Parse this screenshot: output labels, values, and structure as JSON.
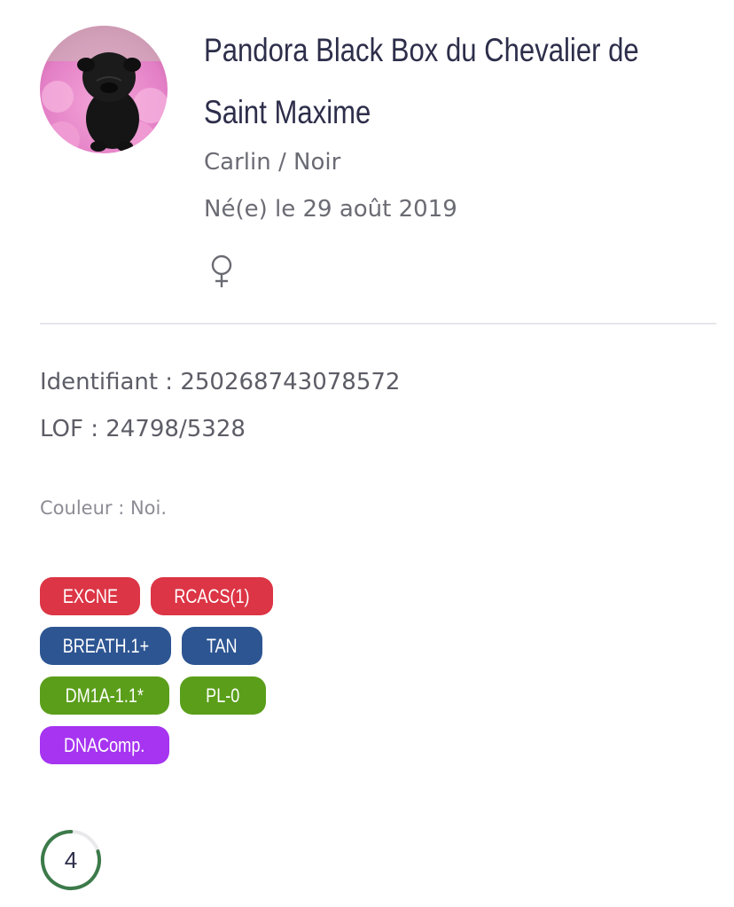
{
  "dog": {
    "name": "Pandora Black Box du Chevalier de Saint Maxime",
    "breed_color": "Carlin / Noir",
    "birth": "Né(e) le 29 août 2019",
    "gender_icon": "female-icon",
    "identifiant": "Identifiant : 250268743078572",
    "lof": "LOF : 24798/5328",
    "couleur": "Couleur : Noi."
  },
  "badges": [
    {
      "label": "EXCNE",
      "color": "#dc3545"
    },
    {
      "label": "RCACS(1)",
      "color": "#dc3545"
    },
    {
      "label": "BREATH.1+",
      "color": "#2d5592"
    },
    {
      "label": "TAN",
      "color": "#2d5592"
    },
    {
      "label": "DM1A-1.1*",
      "color": "#5a9e1a"
    },
    {
      "label": "PL-0",
      "color": "#5a9e1a"
    },
    {
      "label": "DNAComp.",
      "color": "#a634f0"
    }
  ],
  "score": {
    "value": "4",
    "progress_fraction": 0.8,
    "ring_color": "#3c7a4a"
  }
}
